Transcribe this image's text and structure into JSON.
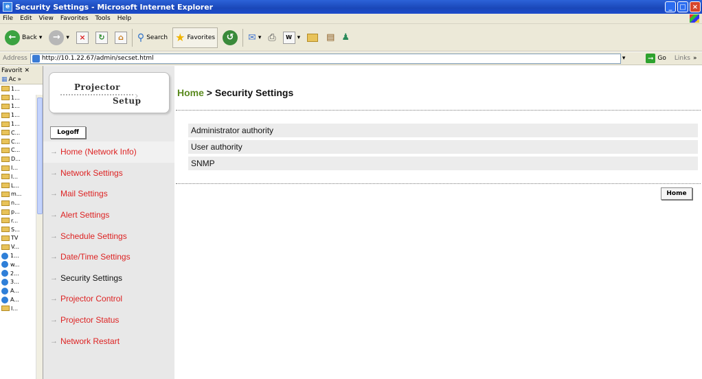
{
  "window": {
    "title": "Security Settings - Microsoft Internet Explorer",
    "controls": [
      "_",
      "□",
      "×"
    ]
  },
  "menu": [
    "File",
    "Edit",
    "View",
    "Favorites",
    "Tools",
    "Help"
  ],
  "toolbar": {
    "back_label": "Back",
    "search_label": "Search",
    "favorites_label": "Favorites"
  },
  "address": {
    "label": "Address",
    "url": "http://10.1.22.67/admin/secset.html",
    "go_label": "Go",
    "links_label": "Links"
  },
  "favorites_pane": {
    "title": "Favorit",
    "sub": "Ac",
    "items": [
      {
        "label": "1...",
        "icon": "folder"
      },
      {
        "label": "1...",
        "icon": "folder"
      },
      {
        "label": "1...",
        "icon": "folder"
      },
      {
        "label": "1...",
        "icon": "folder"
      },
      {
        "label": "1...",
        "icon": "folder"
      },
      {
        "label": "C...",
        "icon": "folder"
      },
      {
        "label": "C...",
        "icon": "folder"
      },
      {
        "label": "C...",
        "icon": "folder"
      },
      {
        "label": "D...",
        "icon": "folder"
      },
      {
        "label": "I...",
        "icon": "folder"
      },
      {
        "label": "I...",
        "icon": "folder"
      },
      {
        "label": "L...",
        "icon": "folder"
      },
      {
        "label": "m...",
        "icon": "folder"
      },
      {
        "label": "n...",
        "icon": "folder"
      },
      {
        "label": "p...",
        "icon": "folder"
      },
      {
        "label": "r...",
        "icon": "folder"
      },
      {
        "label": "S...",
        "icon": "folder"
      },
      {
        "label": "TV",
        "icon": "folder"
      },
      {
        "label": "V...",
        "icon": "folder"
      },
      {
        "label": "1...",
        "icon": "ie"
      },
      {
        "label": "w...",
        "icon": "ie"
      },
      {
        "label": "2...",
        "icon": "ie"
      },
      {
        "label": "3...",
        "icon": "ie"
      },
      {
        "label": "A...",
        "icon": "ie"
      },
      {
        "label": "A...",
        "icon": "ie"
      },
      {
        "label": "I...",
        "icon": "folder"
      }
    ]
  },
  "logo": {
    "line1": "Projector",
    "line2": "Setup"
  },
  "logoff_label": "Logoff",
  "nav": [
    {
      "label": "Home (Network Info)",
      "active": false
    },
    {
      "label": "Network Settings",
      "active": false
    },
    {
      "label": "Mail Settings",
      "active": false
    },
    {
      "label": "Alert Settings",
      "active": false
    },
    {
      "label": "Schedule Settings",
      "active": false
    },
    {
      "label": "Date/Time Settings",
      "active": false
    },
    {
      "label": "Security Settings",
      "active": true
    },
    {
      "label": "Projector Control",
      "active": false
    },
    {
      "label": "Projector Status",
      "active": false
    },
    {
      "label": "Network Restart",
      "active": false
    }
  ],
  "main": {
    "breadcrumb_home": "Home",
    "breadcrumb_rest": " > Security Settings",
    "rows": [
      "Administrator authority",
      "User authority",
      "SNMP"
    ],
    "home_button": "Home"
  },
  "colors": {
    "nav_link": "#dd2222",
    "breadcrumb_home": "#5a8a1e",
    "titlebar": "#1a47b8"
  }
}
